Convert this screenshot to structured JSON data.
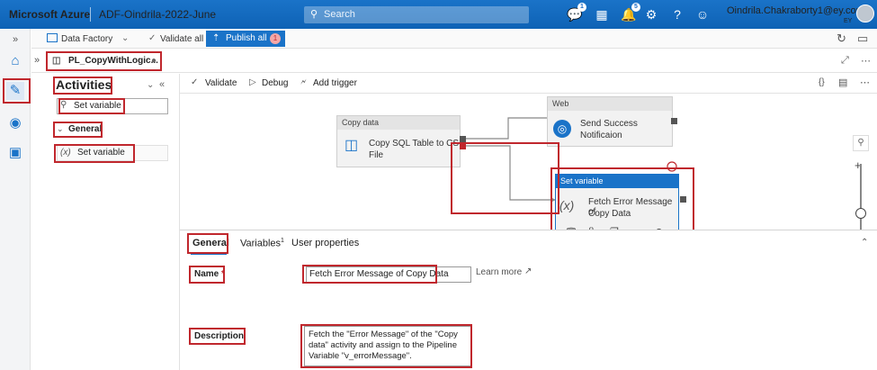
{
  "header": {
    "brand": "Microsoft Azure",
    "factory_name": "ADF-Oindrila-2022-June",
    "search_placeholder": "Search",
    "user_name": "Oindrila.Chakraborty1@ey.com",
    "user_org": "EY",
    "notifications_badge": "1",
    "alerts_badge": "5"
  },
  "toolbar": {
    "data_factory": "Data Factory",
    "validate_all": "Validate all",
    "publish_all": "Publish all",
    "publish_count": "1"
  },
  "tab": {
    "pipeline_name": "PL_CopyWithLogic..."
  },
  "activities": {
    "title": "Activities",
    "search_value": "Set variable",
    "group": "General",
    "item": "Set variable"
  },
  "canvas_toolbar": {
    "validate": "Validate",
    "debug": "Debug",
    "add_trigger": "Add trigger"
  },
  "canvas": {
    "copy_node": {
      "type": "Copy data",
      "name_line1": "Copy SQL Table to CS",
      "name_line2": "File"
    },
    "web_node": {
      "type": "Web",
      "name_line1": "Send Success",
      "name_line2": "Notificaion"
    },
    "setvar_node": {
      "type": "Set variable",
      "name_line1": "Fetch Error Message of",
      "name_line2": "Copy Data"
    }
  },
  "properties": {
    "tabs": [
      "General",
      "Variables",
      "User properties"
    ],
    "variables_sup": "1",
    "name_label": "Name",
    "name_required": "*",
    "name_value": "Fetch Error Message of Copy Data",
    "learn_more": "Learn more",
    "description_label": "Description",
    "description_value": "Fetch the \"Error Message\" of the \"Copy data\" activity and assign to the Pipeline Variable \"v_errorMessage\"."
  },
  "colors": {
    "accent": "#1a73c8",
    "highlight": "#c0272d"
  }
}
